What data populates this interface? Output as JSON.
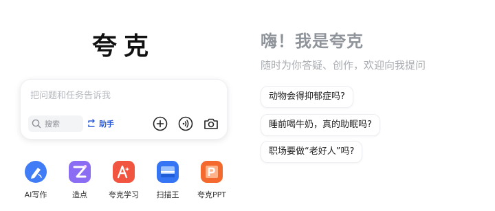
{
  "brand": {
    "logo_text": "夸克"
  },
  "search": {
    "placeholder": "把问题和任务告诉我",
    "mini_search_label": "搜索",
    "assistant_label": "助手",
    "tools": [
      "plus-icon",
      "voice-icon",
      "camera-icon"
    ]
  },
  "apps": [
    {
      "label": "AI写作",
      "icon": "ai-writing-icon",
      "color": "#3f7cf6"
    },
    {
      "label": "造点",
      "icon": "zaodian-icon",
      "color": "#8a6df3"
    },
    {
      "label": "夸克学习",
      "icon": "quark-learning-icon",
      "color": "#f2553f"
    },
    {
      "label": "扫描王",
      "icon": "scanner-icon",
      "color": "#3575f4"
    },
    {
      "label": "夸克PPT",
      "icon": "ppt-icon",
      "color": "#f46a2e"
    }
  ],
  "assistant": {
    "greeting": "嗨！我是夸克",
    "subtitle": "随时为你答疑、创作，欢迎向我提问",
    "suggestions": [
      "动物会得抑郁症吗?",
      "睡前喝牛奶，真的助眠吗?",
      "职场要做“老好人”吗?"
    ]
  }
}
